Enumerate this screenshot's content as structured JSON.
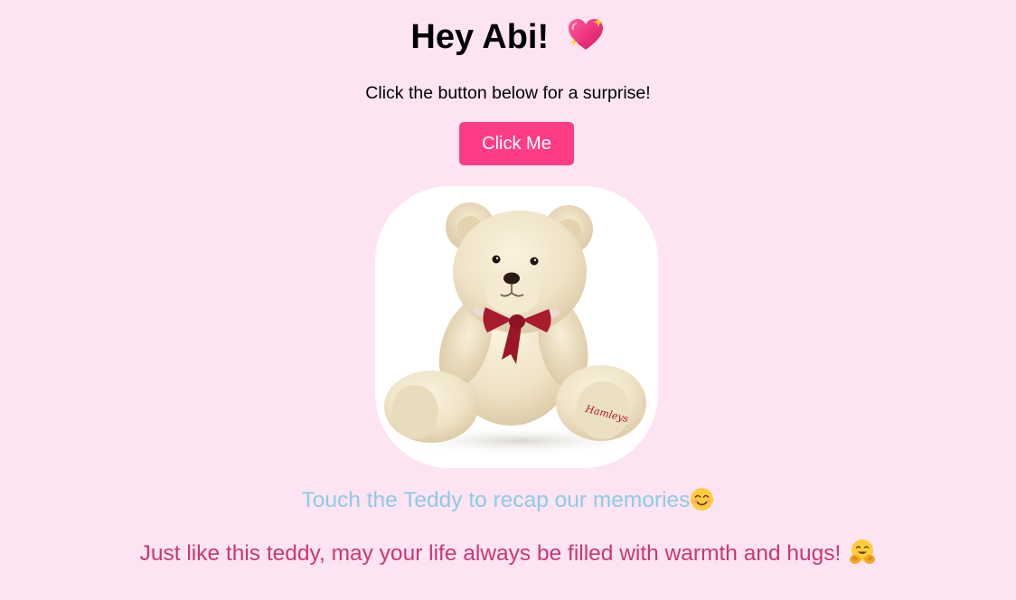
{
  "header": {
    "title": "Hey Abi!",
    "title_icon": "sparkling-heart-icon"
  },
  "intro": {
    "text": "Click the button below for a surprise!"
  },
  "surprise_button": {
    "label": "Click Me"
  },
  "teddy": {
    "image": "teddy-bear-photo",
    "paw_logo": "Hamleys"
  },
  "touch_prompt": {
    "text": "Touch the Teddy to recap our memories",
    "icon": "smiling-face-icon"
  },
  "wish": {
    "text": "Just like this teddy, may your life always be filled with warmth and hugs!",
    "icon": "hugging-face-icon"
  },
  "colors": {
    "background": "#fde4f2",
    "button": "#ff3d86",
    "touch_text": "#8ecbe6",
    "wish_text": "#cc3579"
  }
}
